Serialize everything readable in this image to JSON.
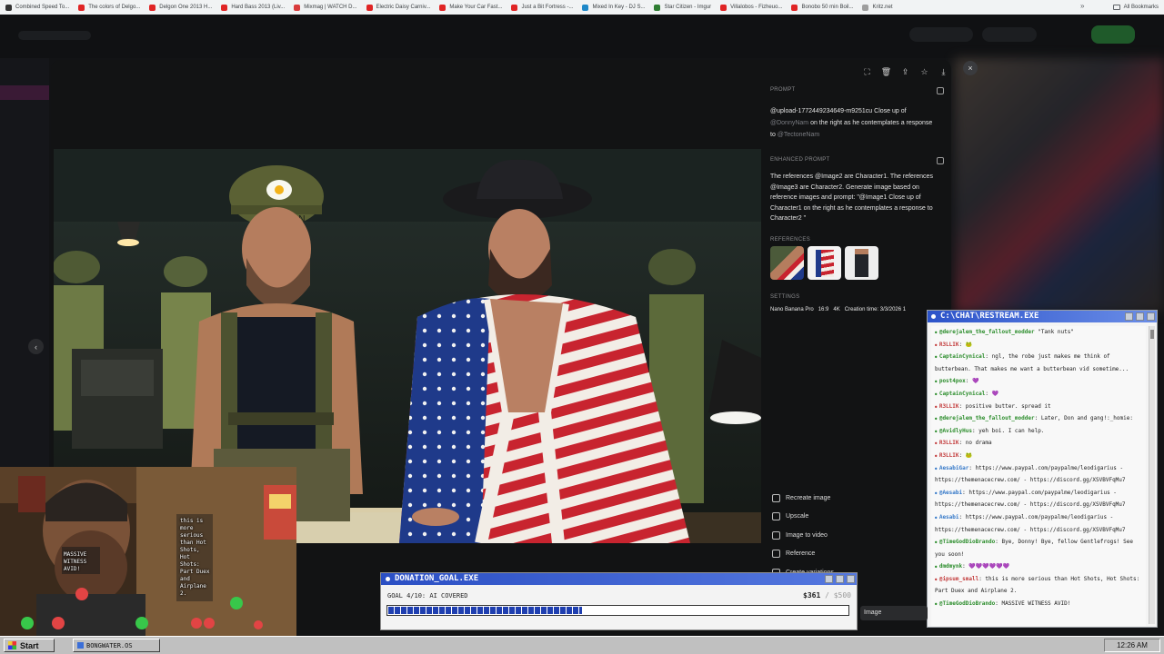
{
  "bookmarks": [
    {
      "label": "Combined Speed To...",
      "color": "#333333"
    },
    {
      "label": "The colors of Delgo...",
      "color": "#e02424"
    },
    {
      "label": "Delgon One 2013 H...",
      "color": "#e02424"
    },
    {
      "label": "Hard Bass 2013 (Liv...",
      "color": "#e02424"
    },
    {
      "label": "Mixmag | WATCH D...",
      "color": "#d93c3c"
    },
    {
      "label": "Electric Daisy Carniv...",
      "color": "#e02424"
    },
    {
      "label": "Make Your Car Fast...",
      "color": "#e02424"
    },
    {
      "label": "Just a Bit Fortress -...",
      "color": "#e02424"
    },
    {
      "label": "Mixed In Key - DJ S...",
      "color": "#1e88c8"
    },
    {
      "label": "Star Citizen - Imgur",
      "color": "#2e7d32"
    },
    {
      "label": "Villalobos - Fizheuo...",
      "color": "#e02424"
    },
    {
      "label": "Bonobo 50 min Boil...",
      "color": "#e02424"
    },
    {
      "label": "Kritz.net",
      "color": "#9e9e9e"
    }
  ],
  "bookmarks_more": "»",
  "all_bookmarks": "All Bookmarks",
  "modal": {
    "close_icon": "×",
    "prompt_label": "PROMPT",
    "prompt_prefix": "@upload-1772449234649-m9251cu Close up of",
    "prompt_mention1": "@DonnyNam",
    "prompt_middle": "on the right as he contemplates a response",
    "prompt_to": "to",
    "prompt_mention2": "@TectoneNam",
    "enhanced_label": "ENHANCED PROMPT",
    "enhanced_text": "The references @Image2 are Character1. The references @Image3 are Character2. Generate image based on reference images and prompt: \"@Image1 Close up of Character1 on the right as he contemplates a response to Character2 \"",
    "references_label": "REFERENCES",
    "settings_label": "SETTINGS",
    "settings": [
      "Nano Banana Pro",
      "16:9",
      "4K",
      "Creation time: 3/3/2026 1"
    ],
    "actions": [
      "Recreate image",
      "Upscale",
      "Image to video",
      "Reference",
      "Create variations"
    ],
    "image_chip": "Image"
  },
  "chat": {
    "title": "C:\\CHAT\\RESTREAM.EXE",
    "messages": [
      {
        "user": "@derejalem_the_fallout_modder",
        "text": " \"Tank nuts\"",
        "color": "#2a8c2a"
      },
      {
        "user": "R3LLIK",
        "text": ": 🐸",
        "color": "#c23b3b"
      },
      {
        "user": "CaptainCynical",
        "text": ": ngl, the robe just makes me think of butterbean. That makes me want a butterbean vid sometime...",
        "color": "#2a8c2a"
      },
      {
        "user": "post4pox",
        "text": ": 💜",
        "color": "#2a8c2a"
      },
      {
        "user": "CaptainCynical",
        "text": ": 💜",
        "color": "#2a8c2a"
      },
      {
        "user": "R3LLIK",
        "text": ": positive butter. spread it",
        "color": "#c23b3b"
      },
      {
        "user": "@derejalem_the_fallout_modder",
        "text": ": Later, Don and gang!:_homie:",
        "color": "#2a8c2a"
      },
      {
        "user": "@AvidlyHus",
        "text": ": yeh boi. I can help.",
        "color": "#2a8c2a"
      },
      {
        "user": "R3LLIK",
        "text": ": no drama",
        "color": "#c23b3b"
      },
      {
        "user": "R3LLIK",
        "text": ": 🐸",
        "color": "#c23b3b"
      },
      {
        "user": "AesabiGar",
        "text": ": https://www.paypal.com/paypalme/leodigarius - https://themenacecrew.com/ - https://discord.gg/XSVBVFqMu7",
        "color": "#3478c8"
      },
      {
        "user": "@Aesabi",
        "text": ": https://www.paypal.com/paypalme/leodigarius - https://themenacecrew.com/ - https://discord.gg/XSVBVFqMu7",
        "color": "#3478c8"
      },
      {
        "user": "Aesabi",
        "text": ": https://www.paypal.com/paypalme/leodigarius - https://themenacecrew.com/ - https://discord.gg/XSVBVFqMu7",
        "color": "#3478c8"
      },
      {
        "user": "@TimeGodDioBrando",
        "text": ": Bye, Donny! Bye, fellow Gentlefrogs! See you soon!",
        "color": "#2a8c2a"
      },
      {
        "user": "dmdmynk",
        "text": ": 💜💜💜💜💜💜",
        "color": "#2a8c2a"
      },
      {
        "user": "@ipsum_small",
        "text": ": this is more serious than Hot Shots, Hot Shots: Part Duex and Airplane 2.",
        "color": "#c23b3b"
      },
      {
        "user": "@TimeGodDioBrando",
        "text": ": MASSIVE WITNESS AVID!",
        "color": "#2a8c2a"
      }
    ]
  },
  "donation": {
    "title": "DONATION_GOAL.EXE",
    "goal_text": "GOAL 4/10: AI COVERED",
    "amount": "$361",
    "max": " / $500",
    "progress": 0.42
  },
  "webcam": {
    "overlay_witness": "MASSIVE WITNESS AVID!",
    "overlay_serious": "this is more serious than Hot Shots, Hot Shots: Part Duex and Airplane 2."
  },
  "taskbar": {
    "start": "Start",
    "task": "BONGWATER.OS",
    "clock": "12:26 AM"
  },
  "colors": {
    "modal_bg": "#121314",
    "titlebar_blue": "#2c53c9",
    "taskbar_gray": "#c0c0c0"
  }
}
